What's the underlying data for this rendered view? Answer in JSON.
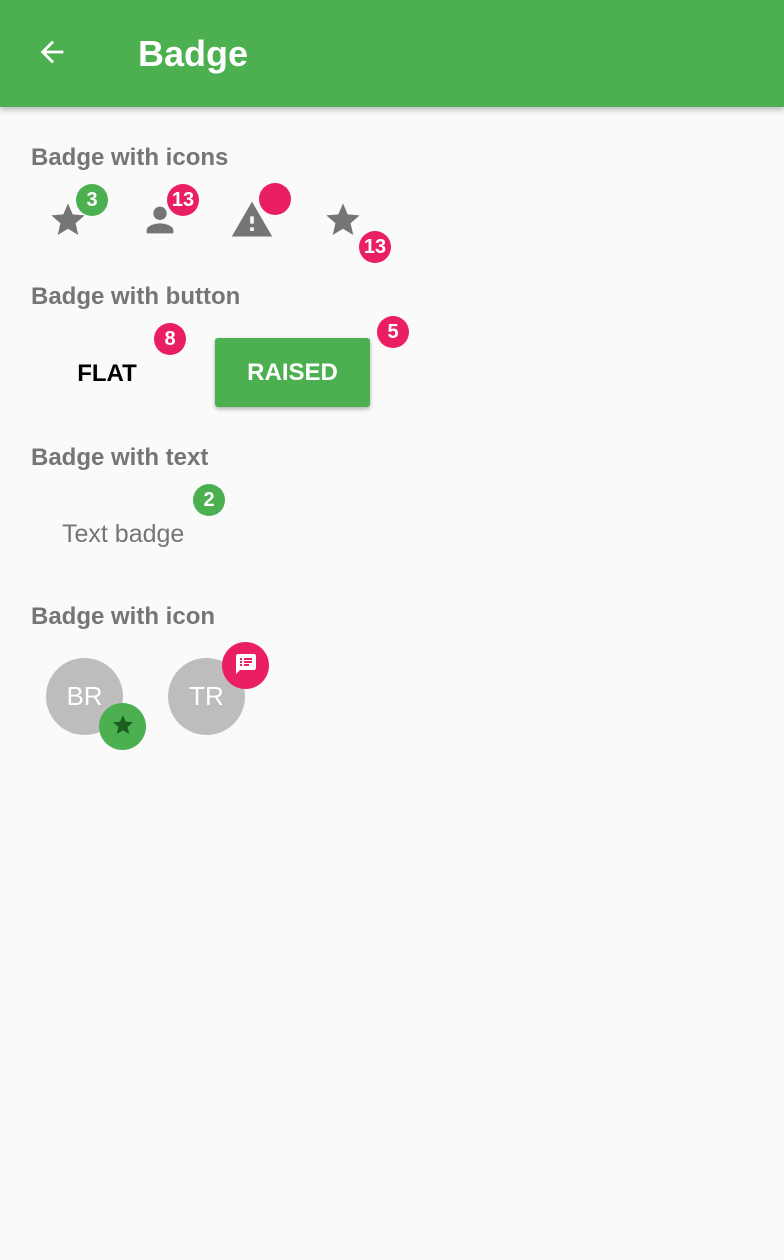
{
  "appbar": {
    "title": "Badge",
    "back_icon": "arrow-back-icon",
    "color": "#4caf50"
  },
  "colors": {
    "green": "#4caf50",
    "pink": "#e91e63",
    "icon_grey": "#757575",
    "avatar_grey": "#bdbdbd"
  },
  "sections": {
    "icons": {
      "title": "Badge with icons",
      "items": [
        {
          "icon": "star-icon",
          "badge": "3"
        },
        {
          "icon": "person-icon",
          "badge": "13"
        },
        {
          "icon": "warning-icon",
          "badge": ""
        },
        {
          "icon": "star-icon",
          "badge": "13"
        }
      ]
    },
    "button": {
      "title": "Badge with button",
      "flat": {
        "label": "FLAT",
        "badge": "8"
      },
      "raised": {
        "label": "RAISED",
        "badge": "5"
      }
    },
    "text": {
      "title": "Badge with text",
      "label": "Text badge",
      "badge": "2"
    },
    "icon": {
      "title": "Badge with icon",
      "avatars": [
        {
          "initials": "BR",
          "badge_icon": "star-icon"
        },
        {
          "initials": "TR",
          "badge_icon": "message-icon"
        }
      ]
    }
  }
}
